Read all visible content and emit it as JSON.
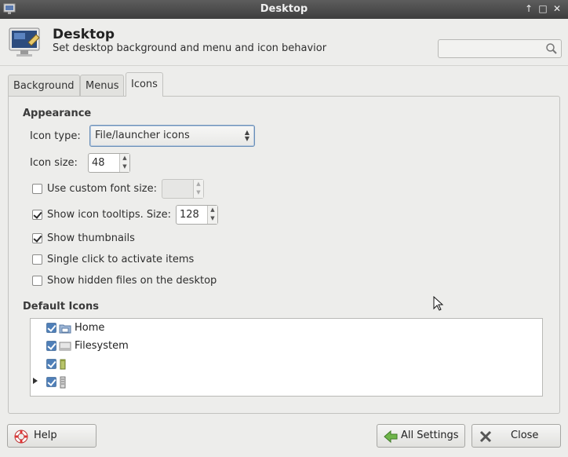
{
  "window": {
    "title": "Desktop"
  },
  "header": {
    "title": "Desktop",
    "subtitle": "Set desktop background and menu and icon behavior",
    "search_placeholder": ""
  },
  "tabs": [
    {
      "label": "Background",
      "mnemonic_index": 0
    },
    {
      "label": "Menus",
      "mnemonic_index": 0
    },
    {
      "label": "Icons",
      "mnemonic_index": 0,
      "active": true
    }
  ],
  "appearance": {
    "title": "Appearance",
    "icon_type_label": "Icon type:",
    "icon_type_value": "File/launcher icons",
    "icon_size_label": "Icon size:",
    "icon_size_value": "48",
    "custom_font_label": "Use custom font size:",
    "custom_font_checked": false,
    "custom_font_value": "",
    "tooltips_label": "Show icon tooltips. Size:",
    "tooltips_checked": true,
    "tooltips_size": "128",
    "thumbnails_label": "Show thumbnails",
    "thumbnails_checked": true,
    "single_click_label": "Single click to activate items",
    "single_click_checked": false,
    "hidden_files_label": "Show hidden files on the desktop",
    "hidden_files_checked": false
  },
  "default_icons": {
    "title": "Default Icons",
    "items": [
      {
        "label": "Home",
        "checked": true,
        "icon": "folder-home-icon"
      },
      {
        "label": "Filesystem",
        "checked": true,
        "icon": "drive-icon"
      },
      {
        "label": "",
        "checked": true,
        "icon": "trash-icon"
      },
      {
        "label": "",
        "checked": true,
        "icon": "removable-drive-icon",
        "expandable": true
      }
    ]
  },
  "buttons": {
    "help": "Help",
    "all_settings": "All Settings",
    "close": "Close"
  },
  "colors": {
    "titlebar": "#4a4a4a",
    "accent": "#4f7fb8",
    "background": "#ededeb"
  }
}
